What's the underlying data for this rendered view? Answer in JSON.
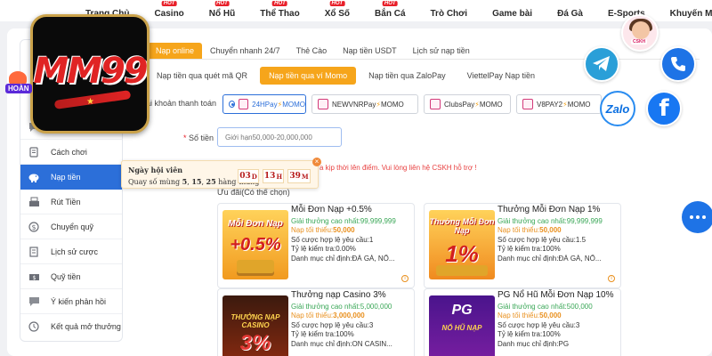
{
  "nav": {
    "items": [
      {
        "label": "Trang Chủ",
        "hot": false
      },
      {
        "label": "Casino",
        "hot": true
      },
      {
        "label": "Nổ Hũ",
        "hot": true
      },
      {
        "label": "Thể Thao",
        "hot": true
      },
      {
        "label": "Xổ Số",
        "hot": true
      },
      {
        "label": "Bắn Cá",
        "hot": true
      },
      {
        "label": "Trò Chơi",
        "hot": false
      },
      {
        "label": "Game bài",
        "hot": false
      },
      {
        "label": "Đá Gà",
        "hot": false
      },
      {
        "label": "E-Sports",
        "hot": false
      },
      {
        "label": "Khuyến Mãi",
        "hot": false
      }
    ],
    "hot_label": "HOT"
  },
  "logo": {
    "text": "MM99"
  },
  "hoan_badge": "HOÀN",
  "sidebar": {
    "items": [
      {
        "label": "",
        "icon": "chat-icon"
      },
      {
        "label": "Cách chơi",
        "icon": "book-icon"
      },
      {
        "label": "Nạp tiền",
        "icon": "piggy-bank-icon",
        "active": true
      },
      {
        "label": "Rút Tiền",
        "icon": "withdraw-icon"
      },
      {
        "label": "Chuyển quỹ",
        "icon": "transfer-icon"
      },
      {
        "label": "Lịch sử cược",
        "icon": "history-icon"
      },
      {
        "label": "Quỹ tiền",
        "icon": "wallet-icon"
      },
      {
        "label": "Ý kiến phản hồi",
        "icon": "feedback-icon"
      },
      {
        "label": "Kết quả mở thưởng",
        "icon": "results-icon"
      }
    ]
  },
  "tabs_main": [
    "Nạp online",
    "Chuyển nhanh 24/7",
    "Thẻ Cào",
    "Nạp tiền USDT",
    "Lịch sử nạp tiền"
  ],
  "tabs_sub": [
    "Nạp tiền qua quét mã QR",
    "Nạp tiền qua ví Momo",
    "Nạp tiền qua ZaloPay",
    "ViettelPay Nạp tiền"
  ],
  "account": {
    "label": "ài khoản thanh toán",
    "options": [
      "24HPay",
      "NEWVNRPay",
      "ClubsPay",
      "V8PAY2"
    ],
    "suffix": "MOMO"
  },
  "amount": {
    "label": "Số tiền",
    "required_mark": "*",
    "placeholder": "Giới hạn50,000-20,000,000"
  },
  "note": "a kịp thời lên điểm. Vui lòng liên hệ CSKH hỗ trợ !",
  "promo_title": "Ưu đãi(Có thể chọn)",
  "promos": [
    {
      "title": "Mỗi Đơn Nạp +0.5%",
      "max_label": "Giải thưởng cao nhất:",
      "max_value": "99,999,999",
      "min_label": "Nạp tối thiểu:",
      "min_value": "50,000",
      "wager": "Số cược hợp lệ yêu cầu:1",
      "check": "Tỷ lệ kiểm tra:0.00%",
      "category": "Danh mục chỉ định:ĐÁ GÀ, NỔ...",
      "img_line1": "Mỗi Đơn Nạp",
      "img_line2": "+0.5%",
      "img_color": "#d21f1f"
    },
    {
      "title": "Thưởng Mỗi Đơn Nạp 1%",
      "max_label": "Giải thưởng cao nhất:",
      "max_value": "99,999,999",
      "min_label": "Nạp tối thiểu:",
      "min_value": "50,000",
      "wager": "Số cược hợp lệ yêu cầu:1.5",
      "check": "Tỷ lệ kiểm tra:100%",
      "category": "Danh mục chỉ định:ĐÁ GÀ, NỔ...",
      "img_line1": "Thưởng Mỗi Đơn Nạp",
      "img_line2": "1%",
      "img_color": "#d21f1f"
    },
    {
      "title": "Thưởng nạp Casino 3%",
      "max_label": "Giải thưởng cao nhất:",
      "max_value": "5,000,000",
      "min_label": "Nạp tối thiểu:",
      "min_value": "3,000,000",
      "wager": "Số cược hợp lệ yêu cầu:3",
      "check": "Tỷ lệ kiểm tra:100%",
      "category": "Danh mục chỉ định:ON CASIN...",
      "img_line1": "THƯỞNG NẠP CASINO",
      "img_line2": "3%",
      "img_color": "#c62828"
    },
    {
      "title": "PG Nổ Hũ Mỗi Đơn Nạp 10%",
      "max_label": "Giải thưởng cao nhất:",
      "max_value": "500,000",
      "min_label": "Nạp tối thiểu:",
      "min_value": "50,000",
      "wager": "Số cược hợp lệ yêu cầu:3",
      "check": "Tỷ lệ kiểm tra:100%",
      "category": "Danh mục chỉ định:PG",
      "img_line1": "PG",
      "img_line2": "NỔ HŨ NẠP",
      "img_color": "#6a1b9a"
    }
  ],
  "popup": {
    "title": "Ngày hội viên",
    "prefix": "Quay số mùng ",
    "d1": "5",
    "sep1": ", ",
    "d2": "15",
    "sep2": ", ",
    "d3": "25",
    "suffix": " hàng tháng",
    "days": "03",
    "days_unit": "D",
    "hours": "13",
    "hours_unit": "H",
    "minutes": "39",
    "minutes_unit": "M",
    "close": "×"
  },
  "contacts": {
    "cskh": "CSKH",
    "zalo": "Zalo",
    "facebook": "f"
  },
  "colors": {
    "accent_orange": "#f6a51b",
    "active_blue": "#2c6fd9",
    "green": "#3aa757"
  }
}
